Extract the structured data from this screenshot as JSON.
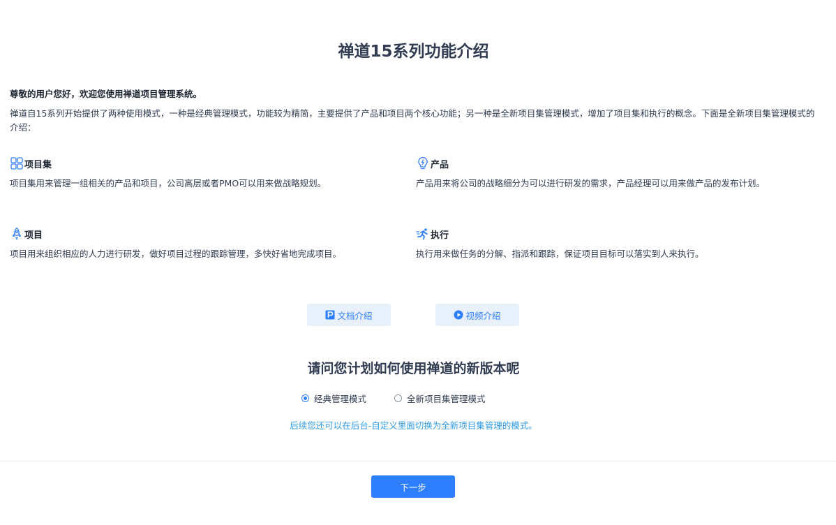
{
  "title": "禅道15系列功能介绍",
  "greeting": "尊敬的用户您好，欢迎您使用禅道项目管理系统。",
  "intro": "禅道自15系列开始提供了两种使用模式，一种是经典管理模式，功能较为精简，主要提供了产品和项目两个核心功能；另一种是全新项目集管理模式，增加了项目集和执行的概念。下面是全新项目集管理模式的介绍：",
  "features": [
    {
      "icon": "grid-icon",
      "title": "项目集",
      "desc": "项目集用来管理一组相关的产品和项目，公司高层或者PMO可以用来做战略规划。"
    },
    {
      "icon": "lightbulb-icon",
      "title": "产品",
      "desc": "产品用来将公司的战略细分为可以进行研发的需求，产品经理可以用来做产品的发布计划。"
    },
    {
      "icon": "rocket-icon",
      "title": "项目",
      "desc": "项目用来组织相应的人力进行研发，做好项目过程的跟踪管理，多快好省地完成项目。"
    },
    {
      "icon": "running-icon",
      "title": "执行",
      "desc": "执行用来做任务的分解、指派和跟踪，保证项目目标可以落实到人来执行。"
    }
  ],
  "buttons": {
    "doc_intro": "文档介绍",
    "video_intro": "视频介绍",
    "next": "下一步"
  },
  "question": "请问您计划如何使用禅道的新版本呢",
  "modes": {
    "selected": "classic",
    "classic_label": "经典管理模式",
    "new_label": "全新项目集管理模式"
  },
  "hint": "后续您还可以在后台-自定义里面切换为全新项目集管理的模式。",
  "colors": {
    "accent": "#2e7fff",
    "hint": "#2e9ae6",
    "button_light_bg": "#e8f0fb"
  }
}
